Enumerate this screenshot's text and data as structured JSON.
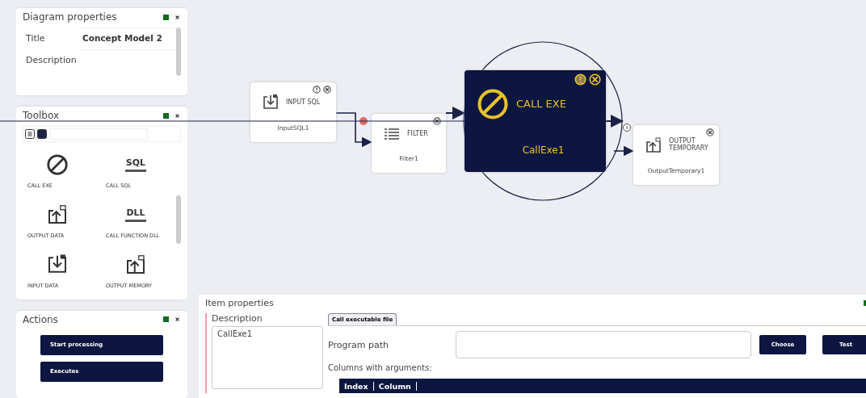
{
  "diagram_properties": {
    "title": "Diagram properties",
    "fields": [
      {
        "label": "Title",
        "value": "Concept Model 2"
      },
      {
        "label": "Description"
      }
    ]
  },
  "toolbox": {
    "title": "Toolbox",
    "view_modes": [
      {
        "kind": "list",
        "selected": false
      },
      {
        "kind": "tiles",
        "selected": true
      }
    ],
    "icon_texts": [
      "SQL",
      "DLL"
    ],
    "items": [
      {
        "kind": "exe",
        "label": "CALL EXE"
      },
      {
        "kind": "sql",
        "label": "CALL SQL"
      },
      {
        "kind": "output",
        "label": "OUTPUT DATA"
      },
      {
        "kind": "dll",
        "label": "CALL FUNCTION DLL"
      },
      {
        "kind": "input",
        "label": "INPUT DATA"
      },
      {
        "kind": "output",
        "label": "OUTPUT MEMORY"
      }
    ]
  },
  "actions": {
    "title": "Actions",
    "buttons": [
      "Start processing",
      "Executes"
    ]
  },
  "diagram": {
    "nodes": [
      {
        "kind": "input",
        "title": "INPUT SQL",
        "name": "InputSQL1",
        "selected": false,
        "warning": true
      },
      {
        "kind": "filter",
        "title": "FILTER",
        "name": "Filter1",
        "selected": false,
        "warning": false
      },
      {
        "kind": "exe",
        "title": "CALL EXE",
        "name": "CallExe1",
        "selected": true,
        "warning": true
      },
      {
        "kind": "output",
        "title": "OUTPUT TEMPORARY",
        "name": "OutputTemporary1",
        "selected": false,
        "warning": false
      }
    ]
  },
  "item_properties": {
    "title": "Item properties",
    "description_label": "Description",
    "description": "CallExe1",
    "tabs": [
      {
        "label": "Call executable file",
        "selected": true
      }
    ],
    "program_path_label": "Program path",
    "buttons": [
      "Choose",
      "Test"
    ],
    "columns_label": "Columns with arguments:",
    "table": {
      "columns": [
        "Index",
        "Column"
      ]
    }
  }
}
